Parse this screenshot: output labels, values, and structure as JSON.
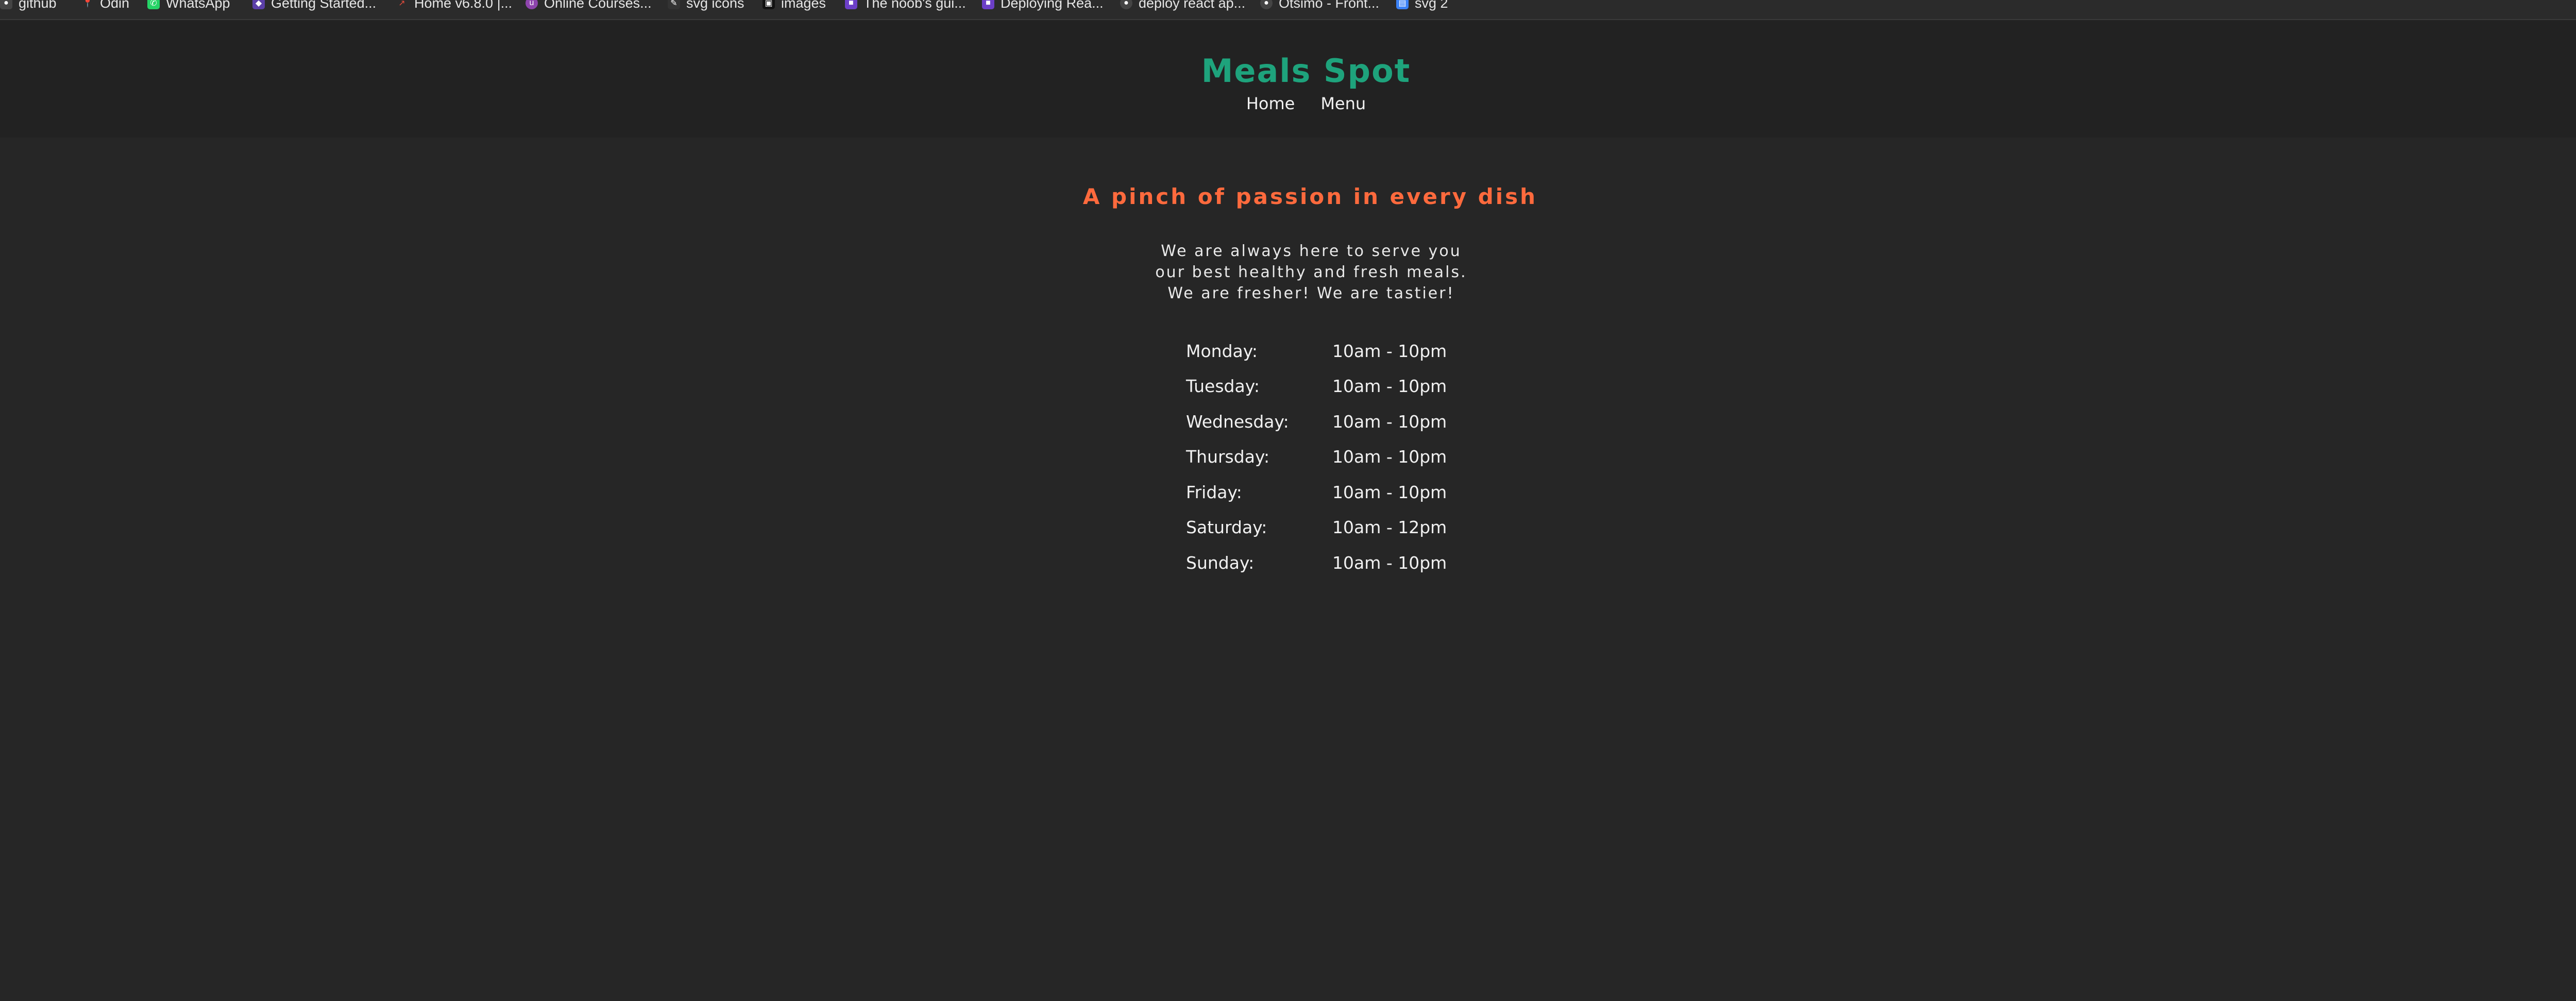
{
  "bookmarks": [
    {
      "label": "github",
      "icon": "github-icon",
      "color": "#444444"
    },
    {
      "label": "Odin",
      "icon": "pin-icon",
      "color": "#555555"
    },
    {
      "label": "WhatsApp",
      "icon": "whatsapp-icon",
      "color": "#25d366"
    },
    {
      "label": "Getting Started...",
      "icon": "page-icon",
      "color": "#5b3fa8"
    },
    {
      "label": "Home v6.8.0 |...",
      "icon": "arrow-icon",
      "color": "#c0392b"
    },
    {
      "label": "Online Courses...",
      "icon": "udemy-icon",
      "color": "#8e44ad"
    },
    {
      "label": "svg icons",
      "icon": "svg-icon",
      "color": "#333333"
    },
    {
      "label": "images",
      "icon": "image-icon",
      "color": "#111111"
    },
    {
      "label": "The noob's gui...",
      "icon": "page-icon",
      "color": "#6c3fc7"
    },
    {
      "label": "Deploying Rea...",
      "icon": "page-icon",
      "color": "#6c3fc7"
    },
    {
      "label": "deploy react ap...",
      "icon": "github-icon",
      "color": "#444444"
    },
    {
      "label": "Otsimo - Front...",
      "icon": "github-icon",
      "color": "#444444"
    },
    {
      "label": "svg 2",
      "icon": "svg-icon",
      "color": "#3b82f6"
    }
  ],
  "site": {
    "brand": "Meals Spot",
    "nav": [
      "Home",
      "Menu"
    ]
  },
  "content": {
    "tagline": "A pinch of passion in every dish",
    "intro": "We are always here to serve you our best healthy and fresh meals. We are fresher! We are tastier!",
    "hours": [
      {
        "day": "Monday:",
        "time": "10am - 10pm"
      },
      {
        "day": "Tuesday:",
        "time": "10am - 10pm"
      },
      {
        "day": "Wednesday:",
        "time": "10am - 10pm"
      },
      {
        "day": "Thursday:",
        "time": "10am - 10pm"
      },
      {
        "day": "Friday:",
        "time": "10am - 10pm"
      },
      {
        "day": "Saturday:",
        "time": "10am - 12pm"
      },
      {
        "day": "Sunday:",
        "time": "10am - 10pm"
      }
    ]
  },
  "colors": {
    "brand": "#1ea37c",
    "accent": "#ff6a3d",
    "background": "#262626",
    "header": "#222222"
  }
}
